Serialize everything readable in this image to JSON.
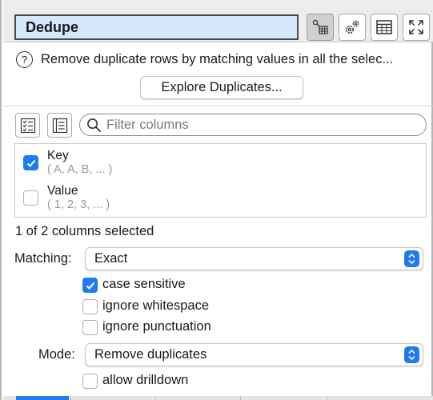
{
  "header": {
    "title": "Dedupe",
    "buttons": [
      {
        "icon": "node-table-icon",
        "active": true
      },
      {
        "icon": "gears-icon",
        "active": false
      },
      {
        "icon": "table-icon",
        "active": false
      },
      {
        "icon": "expand-icon",
        "active": false
      }
    ]
  },
  "description": "Remove duplicate rows by matching values in all the selec...",
  "explore_button": "Explore Duplicates...",
  "filter": {
    "placeholder": "Filter columns"
  },
  "columns": [
    {
      "name": "Key",
      "sample": "( A, A, B, ... )",
      "checked": true
    },
    {
      "name": "Value",
      "sample": "( 1, 2, 3, ... )",
      "checked": false
    }
  ],
  "selected_count": "1 of 2 columns selected",
  "matching": {
    "label": "Matching:",
    "value": "Exact"
  },
  "matching_options": [
    {
      "label": "case sensitive",
      "checked": true
    },
    {
      "label": "ignore whitespace",
      "checked": false
    },
    {
      "label": "ignore punctuation",
      "checked": false
    }
  ],
  "mode": {
    "label": "Mode:",
    "value": "Remove duplicates"
  },
  "allow_drilldown": {
    "label": "allow drilldown",
    "checked": false
  },
  "colors": {
    "accent": "#1f7bf2",
    "title_bg": "#d6e8fb"
  }
}
